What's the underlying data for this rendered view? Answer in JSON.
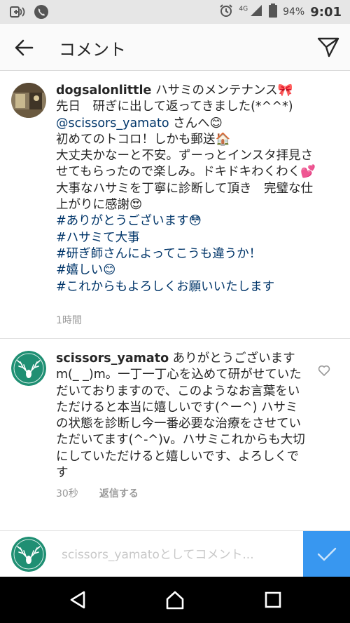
{
  "status_bar": {
    "battery": "94%",
    "time": "9:01",
    "network": "4G"
  },
  "header": {
    "title": "コメント"
  },
  "comments": [
    {
      "username": "dogsalonlittle",
      "line1": " ハサミのメンテナンス🎀",
      "line2": "先日　研ぎに出して返ってきました(*^^*)",
      "mention": "@scissors_yamato",
      "mention_suffix": " さんへ😊",
      "line4": "初めてのトコロ！しかも郵送🏠",
      "line5": "大丈夫かなーと不安。ずーっとインスタ拝見させてもらったので楽しみ。ドキドキわくわく💕",
      "line6": "大事なハサミを丁寧に診断して頂き　完璧な仕上がりに感謝😍",
      "hashtags": [
        "#ありがとうございます😳",
        "#ハサミて大事",
        "#研ぎ師さんによってこうも違うか！",
        "#嬉しい😊",
        "#これからもよろしくお願いいたします"
      ],
      "time": "1時間"
    },
    {
      "username": "scissors_yamato",
      "text": " ありがとうございますm(_ _)m。一丁一丁心を込めて研がせていただいておりますので、このようなお言葉をいただけると本当に嬉しいです(^ー^) ハサミの状態を診断し今一番必要な治療をさせていただいてます(^-^)v。ハサミこれからも大切にしていただけると嬉しいです、よろしくです",
      "time": "30秒",
      "reply_label": "返信する"
    }
  ],
  "input": {
    "placeholder": "scissors_yamatoとしてコメント..."
  },
  "colors": {
    "link": "#003569",
    "post_button": "#3897f0",
    "avatar_green": "#1f8f73"
  }
}
